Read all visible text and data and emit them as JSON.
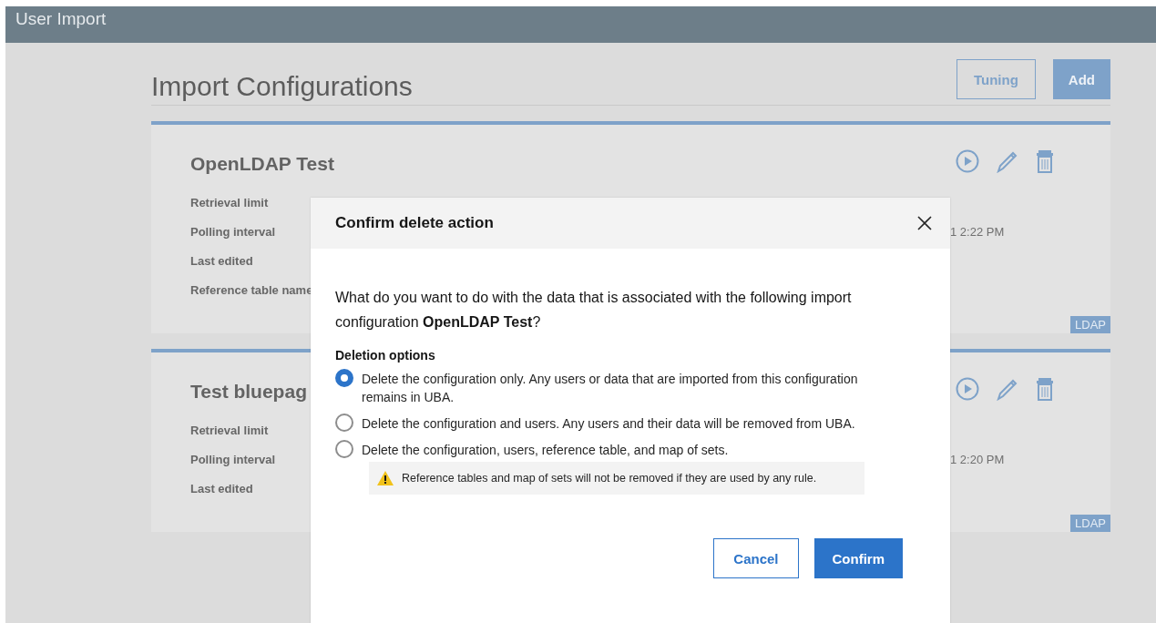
{
  "app_bar": {
    "title": "User Import"
  },
  "page": {
    "title": "Import Configurations",
    "buttons": [
      {
        "label": "Tuning",
        "kind": "secondary"
      },
      {
        "label": "Add",
        "kind": "primary"
      }
    ]
  },
  "configurations": [
    {
      "name": "OpenLDAP Test",
      "fields": [
        {
          "label": "Retrieval limit"
        },
        {
          "label": "Polling interval",
          "value": "1 2:22 PM"
        },
        {
          "label": "Last edited"
        },
        {
          "label": "Reference table name"
        }
      ],
      "tag": "LDAP"
    },
    {
      "name": "Test bluepag",
      "fields": [
        {
          "label": "Retrieval limit"
        },
        {
          "label": "Polling interval",
          "value": "1 2:20 PM"
        },
        {
          "label": "Last edited"
        }
      ],
      "tag": "LDAP"
    }
  ],
  "dialog": {
    "title": "Confirm delete action",
    "message": "What do you want to do with the data that is associated with the following import configuration **OpenLDAP Test**?",
    "options_label": "Deletion options",
    "options": [
      {
        "label": "Delete the configuration only. Any users or data that are imported from this configuration remains in UBA.",
        "selected": true
      },
      {
        "label": "Delete the configuration and users. Any users and their data will be removed from UBA.",
        "selected": false
      },
      {
        "label": "Delete the configuration, users, reference table, and map of sets.",
        "selected": false,
        "warning": "Reference tables and map of sets will not be removed if they are used by any rule."
      }
    ],
    "buttons": [
      {
        "label": "Cancel",
        "kind": "secondary"
      },
      {
        "label": "Confirm",
        "kind": "primary"
      }
    ]
  }
}
